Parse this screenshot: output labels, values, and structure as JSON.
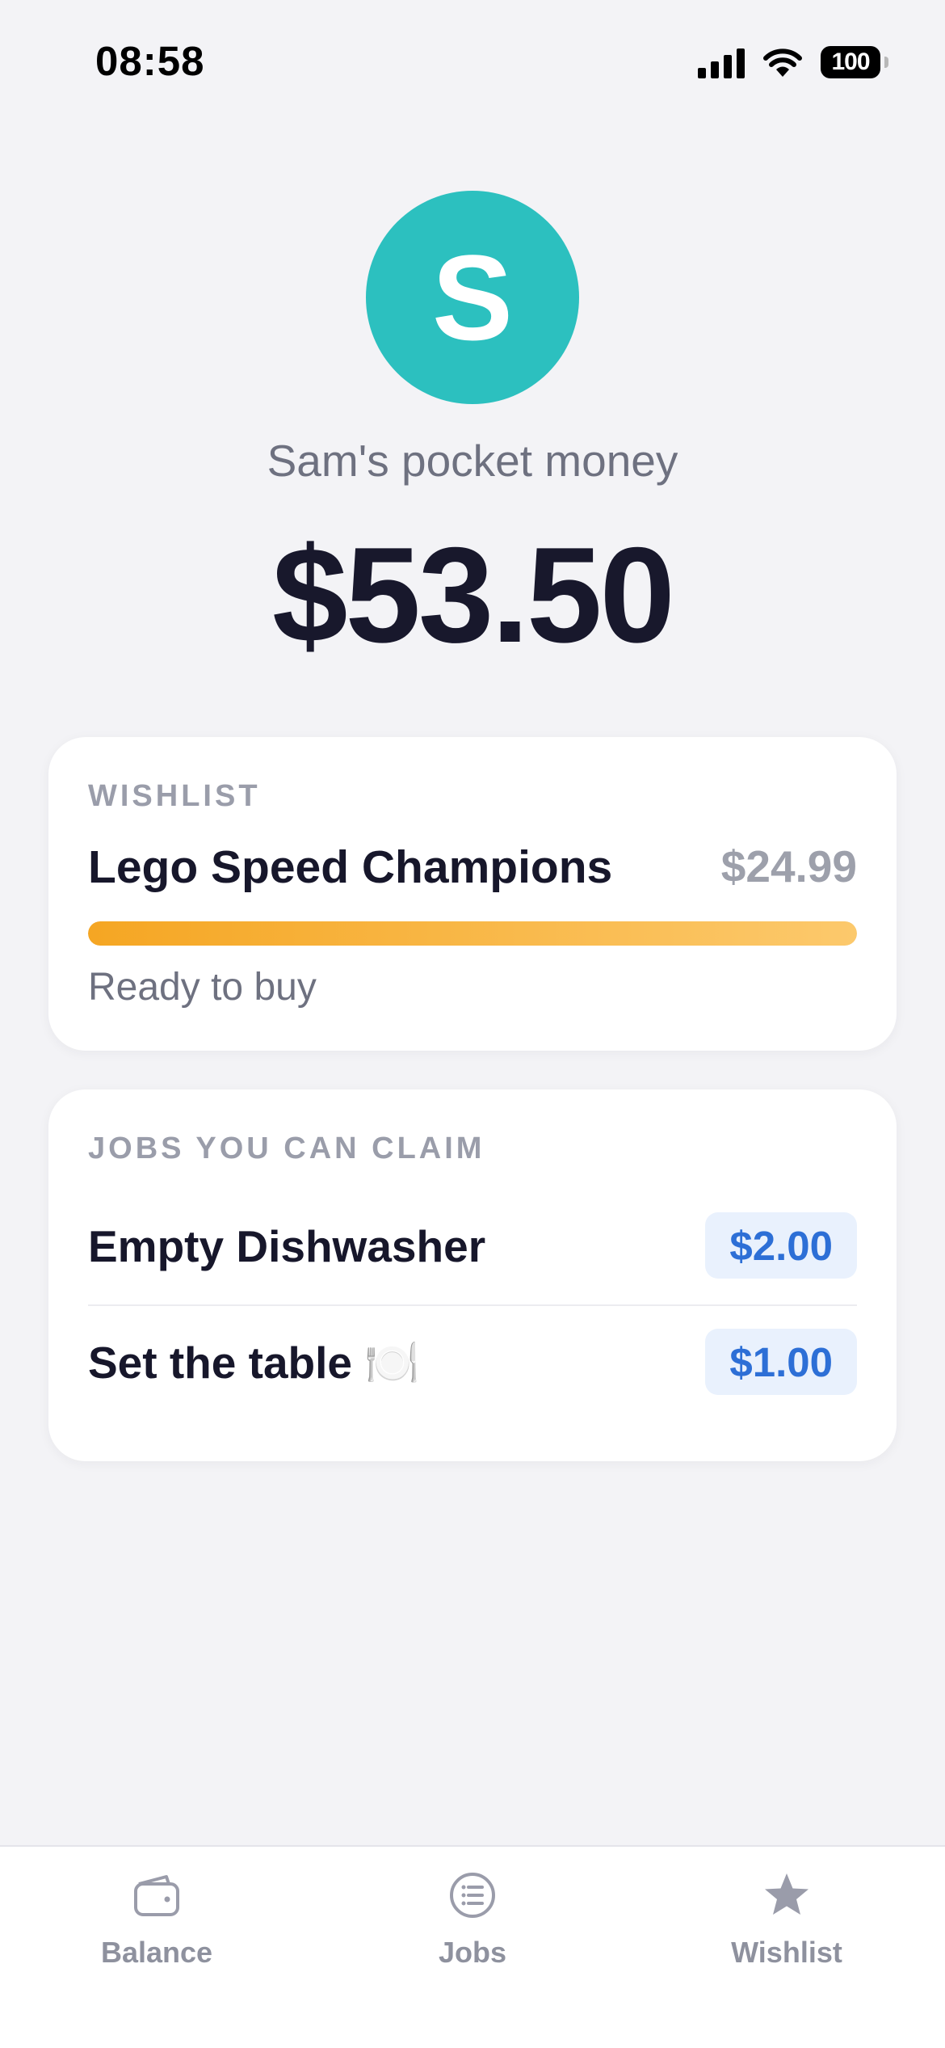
{
  "status_bar": {
    "time": "08:58",
    "battery": "100",
    "icons": [
      "cellular-signal-icon",
      "wifi-icon",
      "battery-icon"
    ]
  },
  "header": {
    "avatar_letter": "S",
    "avatar_color": "#2cc0bf",
    "title": "Sam's pocket money",
    "balance": "$53.50"
  },
  "wishlist_card": {
    "label": "WISHLIST",
    "item_name": "Lego Speed Champions",
    "item_price": "$24.99",
    "progress_percent": 100,
    "status": "Ready to buy",
    "progress_colors": [
      "#f5a623",
      "#fcc96c"
    ]
  },
  "jobs_card": {
    "label": "JOBS YOU CAN CLAIM",
    "jobs": [
      {
        "name": "Empty Dishwasher",
        "reward": "$2.00"
      },
      {
        "name": "Set the table 🍽️",
        "reward": "$1.00"
      }
    ],
    "reward_color": "#2d6fd6"
  },
  "tab_bar": {
    "tabs": [
      {
        "label": "Balance",
        "icon": "wallet-icon"
      },
      {
        "label": "Jobs",
        "icon": "list-icon"
      },
      {
        "label": "Wishlist",
        "icon": "star-icon"
      }
    ]
  }
}
